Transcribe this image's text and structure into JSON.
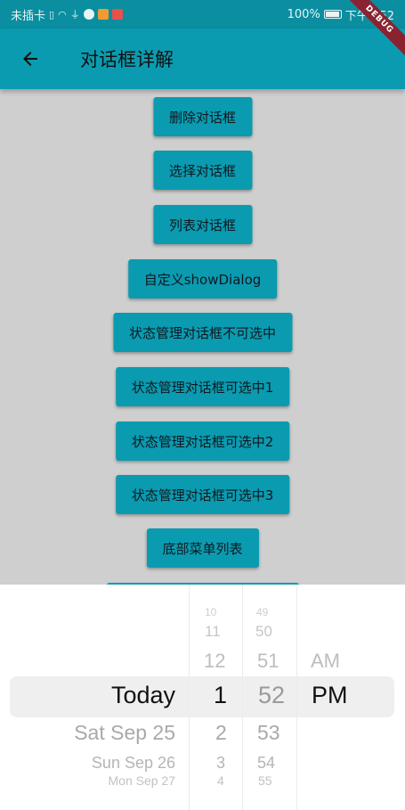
{
  "status_bar": {
    "carrier": "未插卡",
    "battery_percent": "100%",
    "time": "下午4:52",
    "icons": [
      "sim-icon",
      "wifi-icon",
      "usb-icon",
      "app-icon",
      "video-app-icon",
      "message-app-icon",
      "battery-icon"
    ]
  },
  "app_bar": {
    "title": "对话框详解",
    "back_icon": "arrow-back-icon",
    "debug_banner": "DEBUG"
  },
  "buttons": [
    "删除对话框",
    "选择对话框",
    "列表对话框",
    "自定义showDialog",
    "状态管理对话框不可选中",
    "状态管理对话框可选中1",
    "状态管理对话框可选中2",
    "状态管理对话框可选中3",
    "底部菜单列表"
  ],
  "date_picker": {
    "date_column": {
      "selected": "Today",
      "below": [
        "Sat Sep 25",
        "Sun Sep 26",
        "Mon Sep 27"
      ]
    },
    "hour_column": {
      "above": [
        "10",
        "11",
        "12"
      ],
      "selected": "1",
      "below": [
        "2",
        "3",
        "4"
      ]
    },
    "minute_column": {
      "above": [
        "49",
        "50",
        "51"
      ],
      "selected": "52",
      "below": [
        "53",
        "54",
        "55"
      ]
    },
    "ampm_column": {
      "above": [
        "AM"
      ],
      "selected": "PM"
    }
  },
  "colors": {
    "primary": "#0a9bb0",
    "status_bar": "#0a8ea0",
    "scrim": "#cfcfcf",
    "debug_ribbon": "#8b2231"
  }
}
